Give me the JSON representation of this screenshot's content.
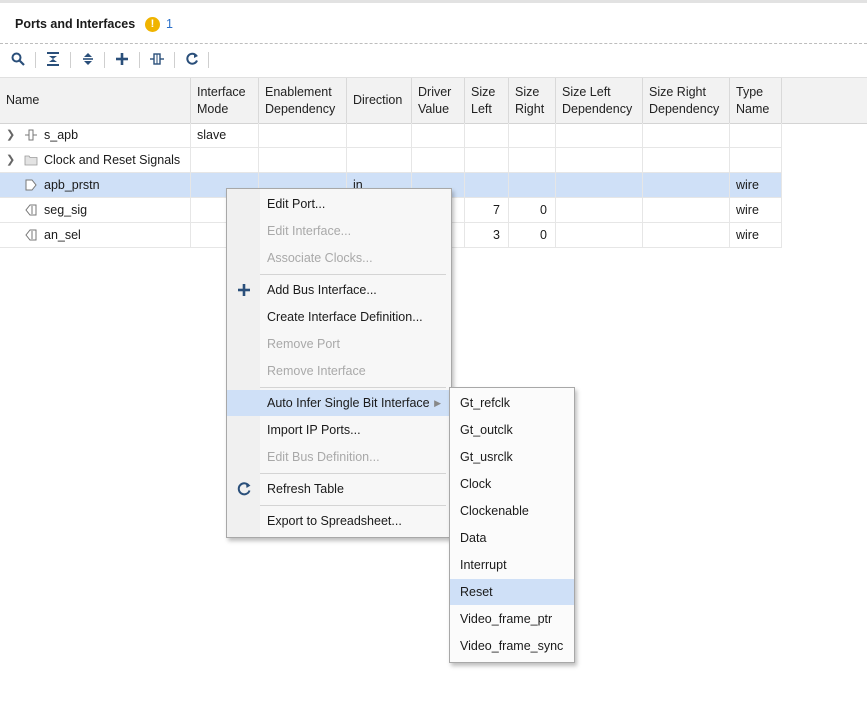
{
  "panel": {
    "title": "Ports and Interfaces",
    "warning_count": "1"
  },
  "toolbar": {
    "icons": [
      "search-icon",
      "collapse-all-icon",
      "expand-all-icon",
      "add-icon",
      "port-icon",
      "refresh-icon"
    ]
  },
  "table": {
    "columns": [
      "Name",
      "Interface Mode",
      "Enablement Dependency",
      "Direction",
      "Driver Value",
      "Size Left",
      "Size Right",
      "Size Left Dependency",
      "Size Right Dependency",
      "Type Name"
    ],
    "rows": [
      {
        "name": "s_apb",
        "interface_mode": "slave",
        "direction": "",
        "size_left": "",
        "size_right": "",
        "type_name": ""
      },
      {
        "name": "Clock and Reset Signals",
        "interface_mode": "",
        "direction": "",
        "size_left": "",
        "size_right": "",
        "type_name": ""
      },
      {
        "name": "apb_prstn",
        "interface_mode": "",
        "direction": "in",
        "size_left": "",
        "size_right": "",
        "type_name": "wire"
      },
      {
        "name": "seg_sig",
        "interface_mode": "",
        "direction": "",
        "size_left": "7",
        "size_right": "0",
        "type_name": "wire"
      },
      {
        "name": "an_sel",
        "interface_mode": "",
        "direction": "",
        "size_left": "3",
        "size_right": "0",
        "type_name": "wire"
      }
    ]
  },
  "context_menu": {
    "items": [
      {
        "label": "Edit Port...",
        "enabled": true
      },
      {
        "label": "Edit Interface...",
        "enabled": false
      },
      {
        "label": "Associate Clocks...",
        "enabled": false
      },
      {
        "label": "Add Bus Interface...",
        "enabled": true,
        "icon": "plus-icon"
      },
      {
        "label": "Create Interface Definition...",
        "enabled": true
      },
      {
        "label": "Remove Port",
        "enabled": false
      },
      {
        "label": "Remove Interface",
        "enabled": false
      },
      {
        "label": "Auto Infer Single Bit Interface",
        "enabled": true,
        "submenu": true
      },
      {
        "label": "Import IP Ports...",
        "enabled": true
      },
      {
        "label": "Edit Bus Definition...",
        "enabled": false
      },
      {
        "label": "Refresh Table",
        "enabled": true,
        "icon": "refresh-icon"
      },
      {
        "label": "Export to Spreadsheet...",
        "enabled": true
      }
    ]
  },
  "submenu": {
    "items": [
      "Gt_refclk",
      "Gt_outclk",
      "Gt_usrclk",
      "Clock",
      "Clockenable",
      "Data",
      "Interrupt",
      "Reset",
      "Video_frame_ptr",
      "Video_frame_sync"
    ],
    "highlighted": "Reset"
  },
  "colors": {
    "selection": "#cfe0f7",
    "warning": "#f0b400",
    "link": "#2a6fc9"
  }
}
